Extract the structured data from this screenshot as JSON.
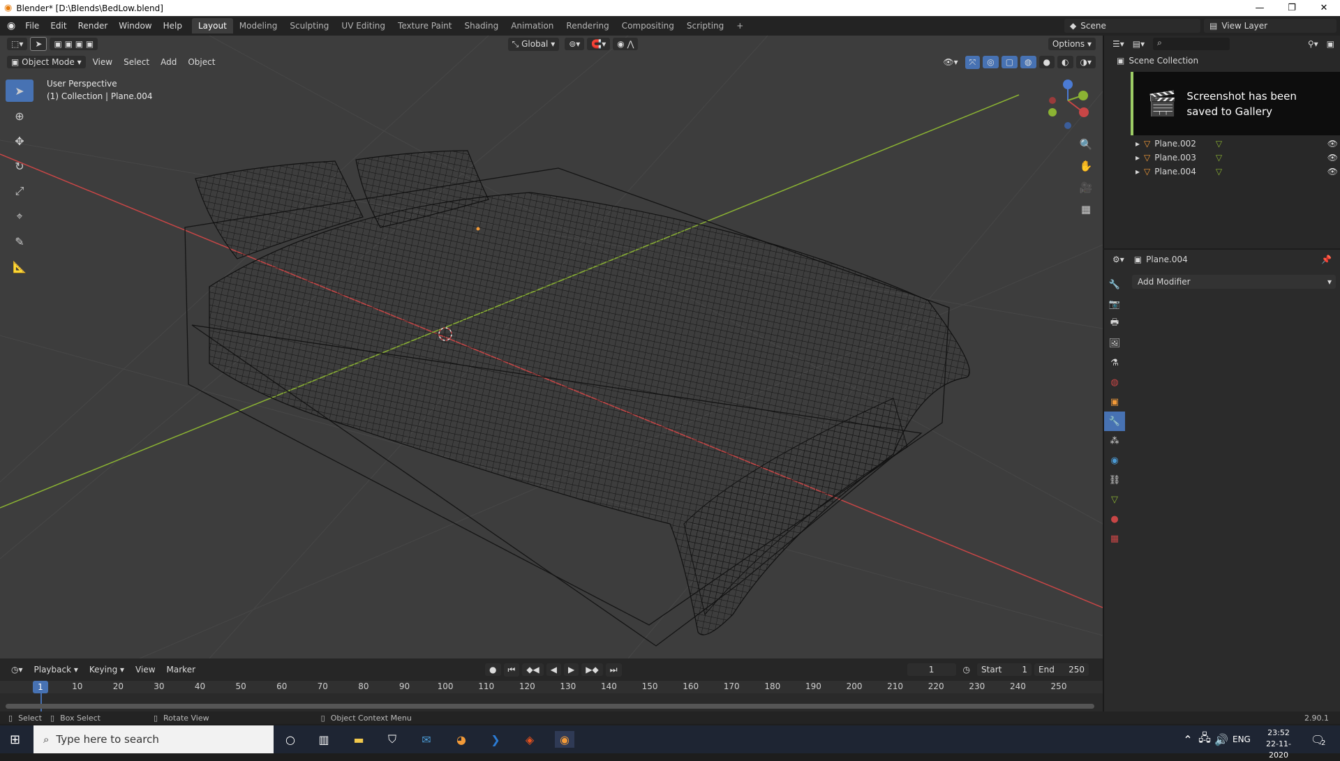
{
  "window": {
    "title": "Blender* [D:\\Blends\\BedLow.blend]",
    "minimize": "—",
    "restore": "❐",
    "close": "✕"
  },
  "menus": [
    "File",
    "Edit",
    "Render",
    "Window",
    "Help"
  ],
  "workspaces": [
    "Layout",
    "Modeling",
    "Sculpting",
    "UV Editing",
    "Texture Paint",
    "Shading",
    "Animation",
    "Rendering",
    "Compositing",
    "Scripting"
  ],
  "active_workspace": "Layout",
  "scene": "Scene",
  "view_layer": "View Layer",
  "viewport": {
    "transform_orientation": "Global",
    "options_label": "Options",
    "mode": "Object Mode",
    "header_menus": [
      "View",
      "Select",
      "Add",
      "Object"
    ],
    "perspective": "User Perspective",
    "collection_info": "(1) Collection | Plane.004"
  },
  "outliner": {
    "root": "Scene Collection",
    "items": [
      "Plane.002",
      "Plane.003",
      "Plane.004"
    ]
  },
  "toast": {
    "text": "Screenshot has been saved to Gallery"
  },
  "properties": {
    "object_name": "Plane.004",
    "add_modifier": "Add Modifier"
  },
  "timeline": {
    "menus": [
      "Playback",
      "Keying",
      "View",
      "Marker"
    ],
    "current_frame": "1",
    "start_label": "Start",
    "start": "1",
    "end_label": "End",
    "end": "250",
    "ticks": [
      "1",
      "10",
      "20",
      "30",
      "40",
      "50",
      "60",
      "70",
      "80",
      "90",
      "100",
      "110",
      "120",
      "130",
      "140",
      "150",
      "160",
      "170",
      "180",
      "190",
      "200",
      "210",
      "220",
      "230",
      "240",
      "250"
    ]
  },
  "statusbar": {
    "select": "Select",
    "box_select": "Box Select",
    "rotate_view": "Rotate View",
    "context_menu": "Object Context Menu",
    "version": "2.90.1"
  },
  "taskbar": {
    "search_placeholder": "Type here to search",
    "lang": "ENG",
    "time": "23:52",
    "date": "22-11-2020",
    "notifications": "2"
  },
  "colors": {
    "accent": "#4772b3",
    "x_axis": "#c84646",
    "y_axis": "#8bb333",
    "toast_bar": "#9ccc65"
  }
}
